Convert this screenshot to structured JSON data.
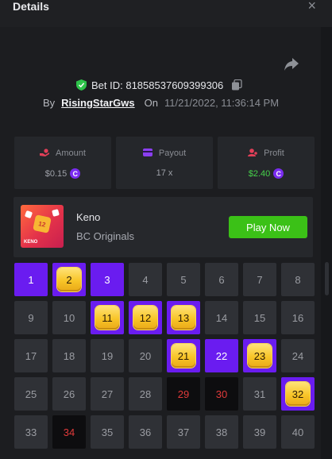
{
  "header": {
    "title": "Details",
    "close_glyph": "×"
  },
  "bet": {
    "id_text": "Bet ID: 81858537609399306",
    "by_label": "By",
    "user": "RisingStarGws",
    "on_label": "On",
    "datetime": "11/21/2022, 11:36:14 PM"
  },
  "stats": {
    "amount": {
      "label": "Amount",
      "value": "$0.15",
      "icon": "coin-hand-icon"
    },
    "payout": {
      "label": "Payout",
      "value": "17 x",
      "icon": "wallet-icon"
    },
    "profit": {
      "label": "Profit",
      "value": "$2.40",
      "icon": "person-icon"
    }
  },
  "game": {
    "name": "Keno",
    "provider": "BC Originals",
    "thumb_label": "KENO",
    "thumb_ball": "12",
    "play_label": "Play Now"
  },
  "coin_glyph": "C",
  "grid": {
    "numbers": [
      1,
      2,
      3,
      4,
      5,
      6,
      7,
      8,
      9,
      10,
      11,
      12,
      13,
      14,
      15,
      16,
      17,
      18,
      19,
      20,
      21,
      22,
      23,
      24,
      25,
      26,
      27,
      28,
      29,
      30,
      31,
      32,
      33,
      34,
      35,
      36,
      37,
      38,
      39,
      40
    ],
    "picked": [
      1,
      3,
      22
    ],
    "hit": [
      2,
      11,
      12,
      13,
      21,
      23,
      32
    ],
    "miss": [
      29,
      30,
      34
    ]
  },
  "colors": {
    "accent_purple": "#6a1cf0",
    "play_green": "#3bc117",
    "profit_green": "#46d14a",
    "miss_red": "#e03a3a",
    "gem_gold": "#f8c528"
  }
}
